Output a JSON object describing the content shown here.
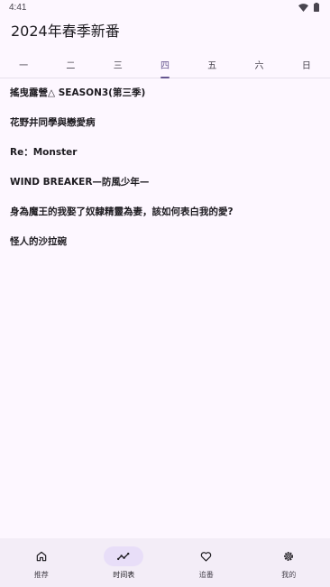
{
  "status": {
    "time": "4:41"
  },
  "app": {
    "title": "2024年春季新番"
  },
  "tabs": [
    {
      "label": "一"
    },
    {
      "label": "二"
    },
    {
      "label": "三"
    },
    {
      "label": "四"
    },
    {
      "label": "五"
    },
    {
      "label": "六"
    },
    {
      "label": "日"
    }
  ],
  "active_tab": "四",
  "anime": [
    {
      "title": "搖曳露營△ SEASON3(第三季)"
    },
    {
      "title": "花野井同學與戀愛病"
    },
    {
      "title": "Re：Monster"
    },
    {
      "title": "WIND BREAKER—防風少年—"
    },
    {
      "title": "身為魔王的我娶了奴隸精靈為妻，該如何表白我的愛?"
    },
    {
      "title": "怪人的沙拉碗"
    }
  ],
  "nav": [
    {
      "label": "推荐",
      "icon": "home-icon"
    },
    {
      "label": "时间表",
      "icon": "timeline-icon"
    },
    {
      "label": "追番",
      "icon": "heart-icon"
    },
    {
      "label": "我的",
      "icon": "settings-icon"
    }
  ],
  "active_nav": "时间表",
  "colors": {
    "accent": "#65558f",
    "background": "#fdf7ff",
    "nav_background": "#f3edf7",
    "nav_pill": "#e8def8"
  }
}
